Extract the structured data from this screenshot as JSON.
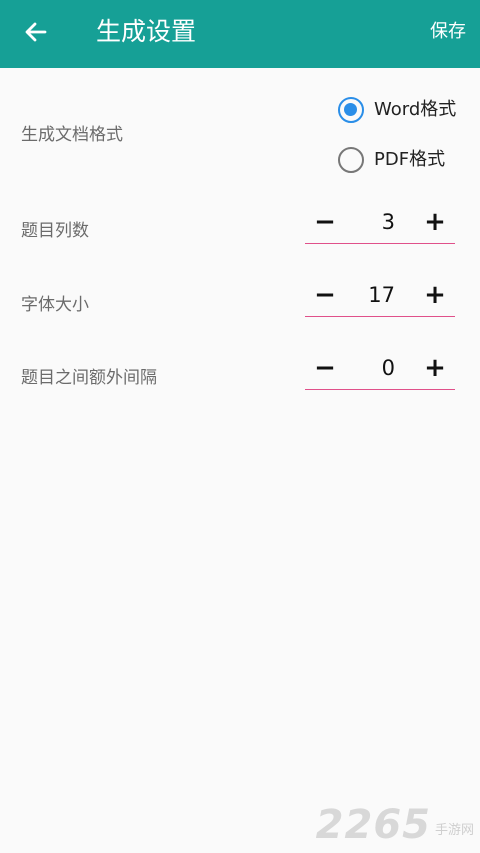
{
  "appbar": {
    "title": "生成设置",
    "save_label": "保存",
    "back_icon": "arrow-left-icon",
    "background": "#16a096"
  },
  "format": {
    "label": "生成文档格式",
    "options": [
      {
        "label": "Word格式",
        "selected": true
      },
      {
        "label": "PDF格式",
        "selected": false
      }
    ],
    "accent": "#2a8ee8"
  },
  "steppers": [
    {
      "label": "题目列数",
      "value": "3"
    },
    {
      "label": "字体大小",
      "value": "17"
    },
    {
      "label": "题目之间额外间隔",
      "value": "0"
    }
  ],
  "stepper_symbols": {
    "minus": "−",
    "plus": "+"
  },
  "underline_color": "#e0508a",
  "watermark": {
    "number": "2265",
    "text": "手游网"
  }
}
